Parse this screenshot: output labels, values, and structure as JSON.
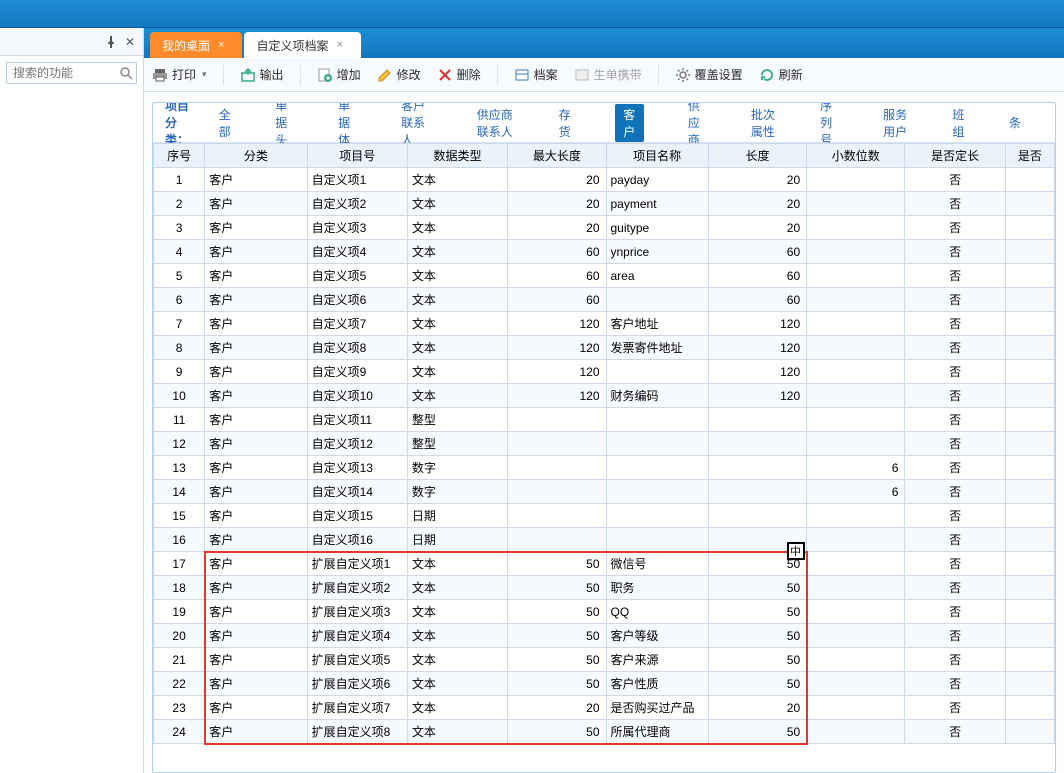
{
  "sidebar": {
    "search_placeholder": "搜索的功能"
  },
  "tabs": [
    {
      "label": "我的桌面",
      "active": false
    },
    {
      "label": "自定义项档案",
      "active": true
    }
  ],
  "toolbar": {
    "print": "打印",
    "export": "输出",
    "add": "增加",
    "edit": "修改",
    "delete": "删除",
    "archive": "档案",
    "portable": "生单携带",
    "cover": "覆盖设置",
    "refresh": "刷新"
  },
  "filters": {
    "label": "项目分类：",
    "items": [
      "全部",
      "单据头",
      "单据体",
      "客户联系人",
      "供应商联系人",
      "存货",
      "客户",
      "供应商",
      "批次属性",
      "序列号",
      "服务用户",
      "班组",
      "条"
    ],
    "selected": "客户"
  },
  "columns": [
    "序号",
    "分类",
    "项目号",
    "数据类型",
    "最大长度",
    "项目名称",
    "长度",
    "小数位数",
    "是否定长",
    "是否"
  ],
  "rows": [
    {
      "idx": "1",
      "cat": "客户",
      "itemno": "自定义项1",
      "dtype": "文本",
      "maxlen": "20",
      "name": "payday",
      "len": "20",
      "dec": "",
      "fixed": "否"
    },
    {
      "idx": "2",
      "cat": "客户",
      "itemno": "自定义项2",
      "dtype": "文本",
      "maxlen": "20",
      "name": "payment",
      "len": "20",
      "dec": "",
      "fixed": "否"
    },
    {
      "idx": "3",
      "cat": "客户",
      "itemno": "自定义项3",
      "dtype": "文本",
      "maxlen": "20",
      "name": "guitype",
      "len": "20",
      "dec": "",
      "fixed": "否"
    },
    {
      "idx": "4",
      "cat": "客户",
      "itemno": "自定义项4",
      "dtype": "文本",
      "maxlen": "60",
      "name": "ynprice",
      "len": "60",
      "dec": "",
      "fixed": "否"
    },
    {
      "idx": "5",
      "cat": "客户",
      "itemno": "自定义项5",
      "dtype": "文本",
      "maxlen": "60",
      "name": "area",
      "len": "60",
      "dec": "",
      "fixed": "否"
    },
    {
      "idx": "6",
      "cat": "客户",
      "itemno": "自定义项6",
      "dtype": "文本",
      "maxlen": "60",
      "name": "",
      "len": "60",
      "dec": "",
      "fixed": "否"
    },
    {
      "idx": "7",
      "cat": "客户",
      "itemno": "自定义项7",
      "dtype": "文本",
      "maxlen": "120",
      "name": "客户地址",
      "len": "120",
      "dec": "",
      "fixed": "否"
    },
    {
      "idx": "8",
      "cat": "客户",
      "itemno": "自定义项8",
      "dtype": "文本",
      "maxlen": "120",
      "name": "发票寄件地址",
      "len": "120",
      "dec": "",
      "fixed": "否"
    },
    {
      "idx": "9",
      "cat": "客户",
      "itemno": "自定义项9",
      "dtype": "文本",
      "maxlen": "120",
      "name": "",
      "len": "120",
      "dec": "",
      "fixed": "否"
    },
    {
      "idx": "10",
      "cat": "客户",
      "itemno": "自定义项10",
      "dtype": "文本",
      "maxlen": "120",
      "name": "财务编码",
      "len": "120",
      "dec": "",
      "fixed": "否"
    },
    {
      "idx": "11",
      "cat": "客户",
      "itemno": "自定义项11",
      "dtype": "整型",
      "maxlen": "",
      "name": "",
      "len": "",
      "dec": "",
      "fixed": "否"
    },
    {
      "idx": "12",
      "cat": "客户",
      "itemno": "自定义项12",
      "dtype": "整型",
      "maxlen": "",
      "name": "",
      "len": "",
      "dec": "",
      "fixed": "否"
    },
    {
      "idx": "13",
      "cat": "客户",
      "itemno": "自定义项13",
      "dtype": "数字",
      "maxlen": "",
      "name": "",
      "len": "",
      "dec": "6",
      "fixed": "否"
    },
    {
      "idx": "14",
      "cat": "客户",
      "itemno": "自定义项14",
      "dtype": "数字",
      "maxlen": "",
      "name": "",
      "len": "",
      "dec": "6",
      "fixed": "否"
    },
    {
      "idx": "15",
      "cat": "客户",
      "itemno": "自定义项15",
      "dtype": "日期",
      "maxlen": "",
      "name": "",
      "len": "",
      "dec": "",
      "fixed": "否"
    },
    {
      "idx": "16",
      "cat": "客户",
      "itemno": "自定义项16",
      "dtype": "日期",
      "maxlen": "",
      "name": "",
      "len": "",
      "dec": "",
      "fixed": "否"
    },
    {
      "idx": "17",
      "cat": "客户",
      "itemno": "扩展自定义项1",
      "dtype": "文本",
      "maxlen": "50",
      "name": "微信号",
      "len": "50",
      "dec": "",
      "fixed": "否"
    },
    {
      "idx": "18",
      "cat": "客户",
      "itemno": "扩展自定义项2",
      "dtype": "文本",
      "maxlen": "50",
      "name": "职务",
      "len": "50",
      "dec": "",
      "fixed": "否"
    },
    {
      "idx": "19",
      "cat": "客户",
      "itemno": "扩展自定义项3",
      "dtype": "文本",
      "maxlen": "50",
      "name": "QQ",
      "len": "50",
      "dec": "",
      "fixed": "否"
    },
    {
      "idx": "20",
      "cat": "客户",
      "itemno": "扩展自定义项4",
      "dtype": "文本",
      "maxlen": "50",
      "name": "客户等级",
      "len": "50",
      "dec": "",
      "fixed": "否"
    },
    {
      "idx": "21",
      "cat": "客户",
      "itemno": "扩展自定义项5",
      "dtype": "文本",
      "maxlen": "50",
      "name": "客户来源",
      "len": "50",
      "dec": "",
      "fixed": "否"
    },
    {
      "idx": "22",
      "cat": "客户",
      "itemno": "扩展自定义项6",
      "dtype": "文本",
      "maxlen": "50",
      "name": "客户性质",
      "len": "50",
      "dec": "",
      "fixed": "否"
    },
    {
      "idx": "23",
      "cat": "客户",
      "itemno": "扩展自定义项7",
      "dtype": "文本",
      "maxlen": "20",
      "name": "是否购买过产品",
      "len": "20",
      "dec": "",
      "fixed": "否"
    },
    {
      "idx": "24",
      "cat": "客户",
      "itemno": "扩展自定义项8",
      "dtype": "文本",
      "maxlen": "50",
      "name": "所属代理商",
      "len": "50",
      "dec": "",
      "fixed": "否"
    }
  ],
  "cursor_char": "中"
}
